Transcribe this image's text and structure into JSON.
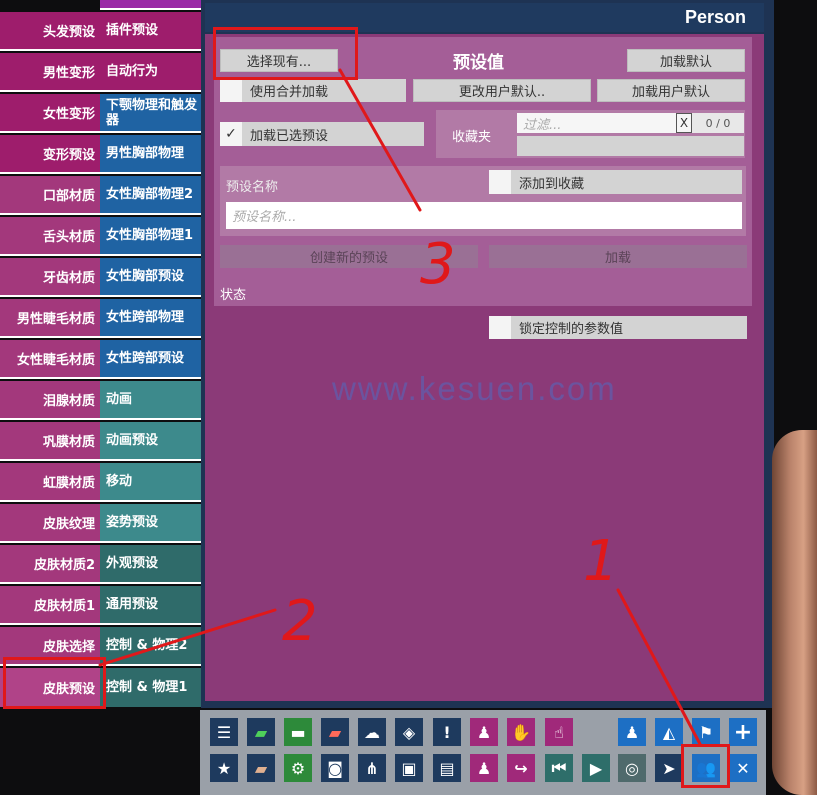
{
  "person_title": "Person",
  "left_tabs": [
    "头发预设",
    "男性变形",
    "女性变形",
    "变形预设",
    "口部材质",
    "舌头材质",
    "牙齿材质",
    "男性睫毛材质",
    "女性睫毛材质",
    "泪腺材质",
    "巩膜材质",
    "虹膜材质",
    "皮肤纹理",
    "皮肤材质2",
    "皮肤材质1",
    "皮肤选择",
    "皮肤预设"
  ],
  "mid_tabs": [
    "插件预设",
    "自动行为",
    "下颚物理和触发器",
    "男性胸部物理",
    "女性胸部物理2",
    "女性胸部物理1",
    "女性胸部预设",
    "女性跨部物理",
    "女性跨部预设",
    "动画",
    "动画预设",
    "移动",
    "姿势预设",
    "外观预设",
    "通用预设",
    "控制 & 物理2",
    "控制 & 物理1"
  ],
  "preset": {
    "select_existing": "选择现有...",
    "title": "预设值",
    "load_default": "加载默认",
    "use_merge_load": "使用合并加载",
    "change_user_default": "更改用户默认..",
    "load_user_default": "加载用户默认",
    "load_selected_preset": "加载已选预设",
    "favorites_label": "收藏夹",
    "filter_placeholder": "过滤...",
    "filter_clear": "X",
    "filter_count": "0 / 0",
    "preset_name_label": "预设名称",
    "add_to_favorites": "添加到收藏",
    "preset_name_placeholder": "预设名称...",
    "create_new_preset": "创建新的预设",
    "load": "加载",
    "status_label": "状态",
    "lock_controlled_params": "锁定控制的参数值"
  },
  "watermark": "www.kesuen.com",
  "annotations": [
    "1",
    "2",
    "3"
  ],
  "colors": {
    "accent_red": "#e0181a",
    "panel": "#8b3a78",
    "header": "#1f3a5f"
  }
}
